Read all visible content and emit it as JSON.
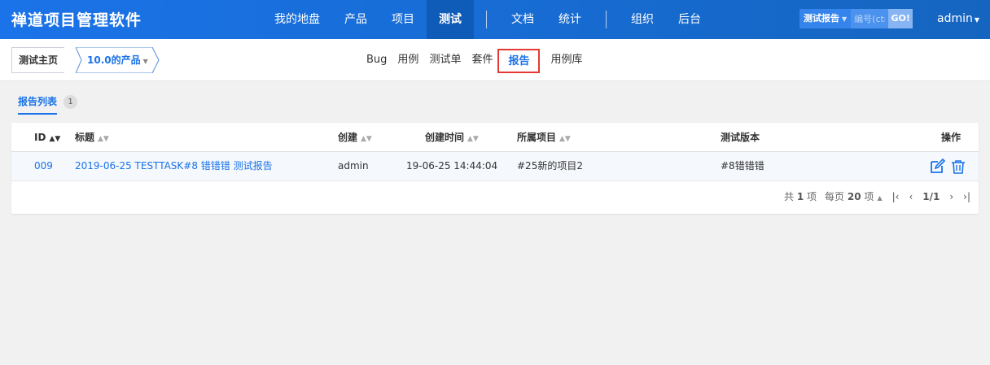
{
  "header": {
    "brand": "禅道项目管理软件",
    "nav": [
      "我的地盘",
      "产品",
      "项目",
      "测试",
      "文档",
      "统计",
      "组织",
      "后台"
    ],
    "active_nav": "测试",
    "search_type": "测试报告",
    "search_placeholder": "编号(ctrl+g)",
    "search_button": "GO!",
    "user": "admin"
  },
  "subnav": {
    "home": "测试主页",
    "product": "10.0的产品",
    "modules": [
      "Bug",
      "用例",
      "测试单",
      "套件",
      "报告",
      "用例库"
    ],
    "active_module": "报告"
  },
  "list": {
    "tab_label": "报告列表",
    "tab_count": "1"
  },
  "table": {
    "columns": {
      "id": "ID",
      "title": "标题",
      "creator": "创建",
      "created_time": "创建时间",
      "project": "所属项目",
      "build": "测试版本",
      "actions": "操作"
    },
    "rows": [
      {
        "id": "009",
        "title": "2019-06-25 TESTTASK#8 错错错 测试报告",
        "creator": "admin",
        "created_time": "19-06-25 14:44:04",
        "project": "#25新的项目2",
        "build": "#8错错错"
      }
    ]
  },
  "pager": {
    "total_prefix": "共",
    "total": "1",
    "total_suffix": "项",
    "per_page_prefix": "每页",
    "per_page": "20",
    "per_page_suffix": "项",
    "page_label": "1/1"
  },
  "colors": {
    "brand": "#1a73e8",
    "highlight_box": "#e53935"
  }
}
